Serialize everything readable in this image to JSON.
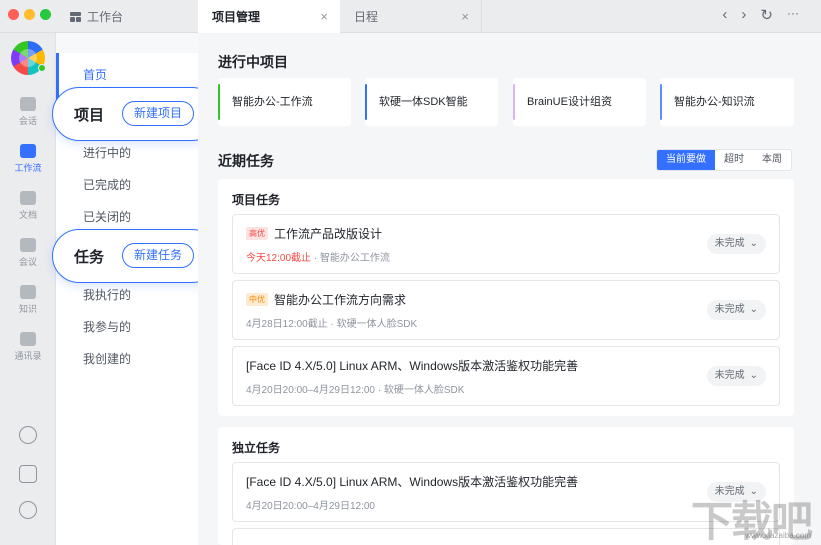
{
  "titlebar": {
    "workbench_tab": "工作台",
    "active_tab": "项目管理",
    "schedule_tab": "日程",
    "close_glyph": "×",
    "nav_back": "‹",
    "nav_forward": "›",
    "refresh": "↻",
    "more": "···"
  },
  "rail": {
    "items": [
      {
        "label": "会话",
        "icon": "chat-icon"
      },
      {
        "label": "工作流",
        "icon": "workflow-icon",
        "active": true
      },
      {
        "label": "文档",
        "icon": "doc-icon"
      },
      {
        "label": "会议",
        "icon": "video-icon"
      },
      {
        "label": "知识",
        "icon": "book-icon"
      },
      {
        "label": "通讯录",
        "icon": "contacts-icon"
      }
    ],
    "bottom_icons": [
      "phone-icon",
      "save-icon",
      "more-circle-icon"
    ]
  },
  "subnav": {
    "home": "首页",
    "projects_heading": "项目",
    "new_project": "新建项目",
    "in_progress": "进行中的",
    "completed": "已完成的",
    "closed": "已关闭的",
    "tasks_heading": "任务",
    "new_task": "新建任务",
    "executing": "我执行的",
    "participating": "我参与的",
    "created": "我创建的"
  },
  "main": {
    "ongoing_title": "进行中项目",
    "projects": [
      "智能办公-工作流",
      "软硬一体SDK智能",
      "BrainUE设计组资",
      "智能办公-知识流"
    ],
    "recent_title": "近期任务",
    "filters": [
      "当前要做",
      "超时",
      "本周"
    ],
    "project_tasks_title": "项目任务",
    "project_tasks": [
      {
        "priority": "高优",
        "title": "工作流产品改版设计",
        "due": "今天12:00截止",
        "meta": " · 智能办公工作流",
        "status": "未完成"
      },
      {
        "priority": "中优",
        "title": "智能办公工作流方向需求",
        "due": "",
        "meta": "4月28日12:00截止 · 软硬一体人脸SDK",
        "status": "未完成"
      },
      {
        "priority": "",
        "title": "[Face ID 4.X/5.0] Linux ARM、Windows版本激活鉴权功能完善",
        "due": "",
        "meta": "4月20日20:00–4月29日12:00 · 软硬一体人脸SDK",
        "status": "未完成"
      }
    ],
    "independent_title": "独立任务",
    "independent_tasks": [
      {
        "title": "[Face ID 4.X/5.0] Linux ARM、Windows版本激活鉴权功能完善",
        "meta": "4月20日20:00–4月29日12:00",
        "status": "未完成"
      }
    ],
    "chevron": "⌄"
  },
  "watermark": {
    "text": "下载吧",
    "url": "www.xiazaiba.com"
  },
  "colors": {
    "accent": "#3370ff",
    "danger": "#f54a45",
    "warning": "#ff8800"
  }
}
